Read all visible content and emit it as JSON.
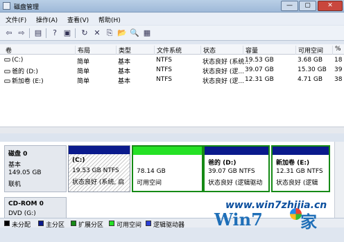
{
  "window": {
    "title": "磁盘管理",
    "min": "—",
    "max": "▢",
    "close": "✕"
  },
  "menu": [
    "文件(F)",
    "操作(A)",
    "查看(V)",
    "帮助(H)"
  ],
  "toolbar": {
    "back": "⇦",
    "forward": "⇨",
    "icons": [
      "▤",
      "?",
      "▣",
      "↻",
      "✕",
      "⎘",
      "📂",
      "🔍",
      "▦"
    ]
  },
  "columns": [
    "卷",
    "布局",
    "类型",
    "文件系统",
    "状态",
    "容量",
    "可用空间",
    "%"
  ],
  "volumes": [
    {
      "name": "(C:)",
      "layout": "简单",
      "type": "基本",
      "fs": "NTFS",
      "status": "状态良好 (系统...",
      "capacity": "19.53 GB",
      "free": "3.68 GB",
      "pct": "18"
    },
    {
      "name": "爸的 (D:)",
      "layout": "简单",
      "type": "基本",
      "fs": "NTFS",
      "status": "状态良好 (逻...",
      "capacity": "39.07 GB",
      "free": "15.30 GB",
      "pct": "39"
    },
    {
      "name": "新加卷 (E:)",
      "layout": "简单",
      "type": "基本",
      "fs": "NTFS",
      "status": "状态良好 (逻...",
      "capacity": "12.31 GB",
      "free": "4.71 GB",
      "pct": "38"
    }
  ],
  "disk0": {
    "name": "磁盘 0",
    "kind": "基本",
    "size": "149.05 GB",
    "state": "联机"
  },
  "partitions": [
    {
      "title": "(C:)",
      "size": "19.53 GB NTFS",
      "status": "状态良好 (系统, 启",
      "bar": "#0a1a8c"
    },
    {
      "title": "",
      "size": "78.14 GB",
      "status": "可用空间",
      "bar": "#25e125"
    },
    {
      "title": "爸的  (D:)",
      "size": "39.07 GB NTFS",
      "status": "状态良好 (逻辑驱动",
      "bar": "#0a1a8c"
    },
    {
      "title": "新加卷  (E:)",
      "size": "12.31 GB NTFS",
      "status": "状态良好 (逻辑",
      "bar": "#0a1a8c"
    }
  ],
  "cdrom": {
    "name": "CD-ROM 0",
    "desc": "DVD (G:)"
  },
  "legend": [
    {
      "label": "未分配",
      "color": "#000000"
    },
    {
      "label": "主分区",
      "color": "#0a1a8c"
    },
    {
      "label": "扩展分区",
      "color": "#168a16"
    },
    {
      "label": "可用空间",
      "color": "#25e125"
    },
    {
      "label": "逻辑驱动器",
      "color": "#2a3fd6"
    }
  ],
  "watermark": {
    "url": "www.win7zhijia.cn",
    "brand": "Win7",
    "suffix": "家"
  }
}
